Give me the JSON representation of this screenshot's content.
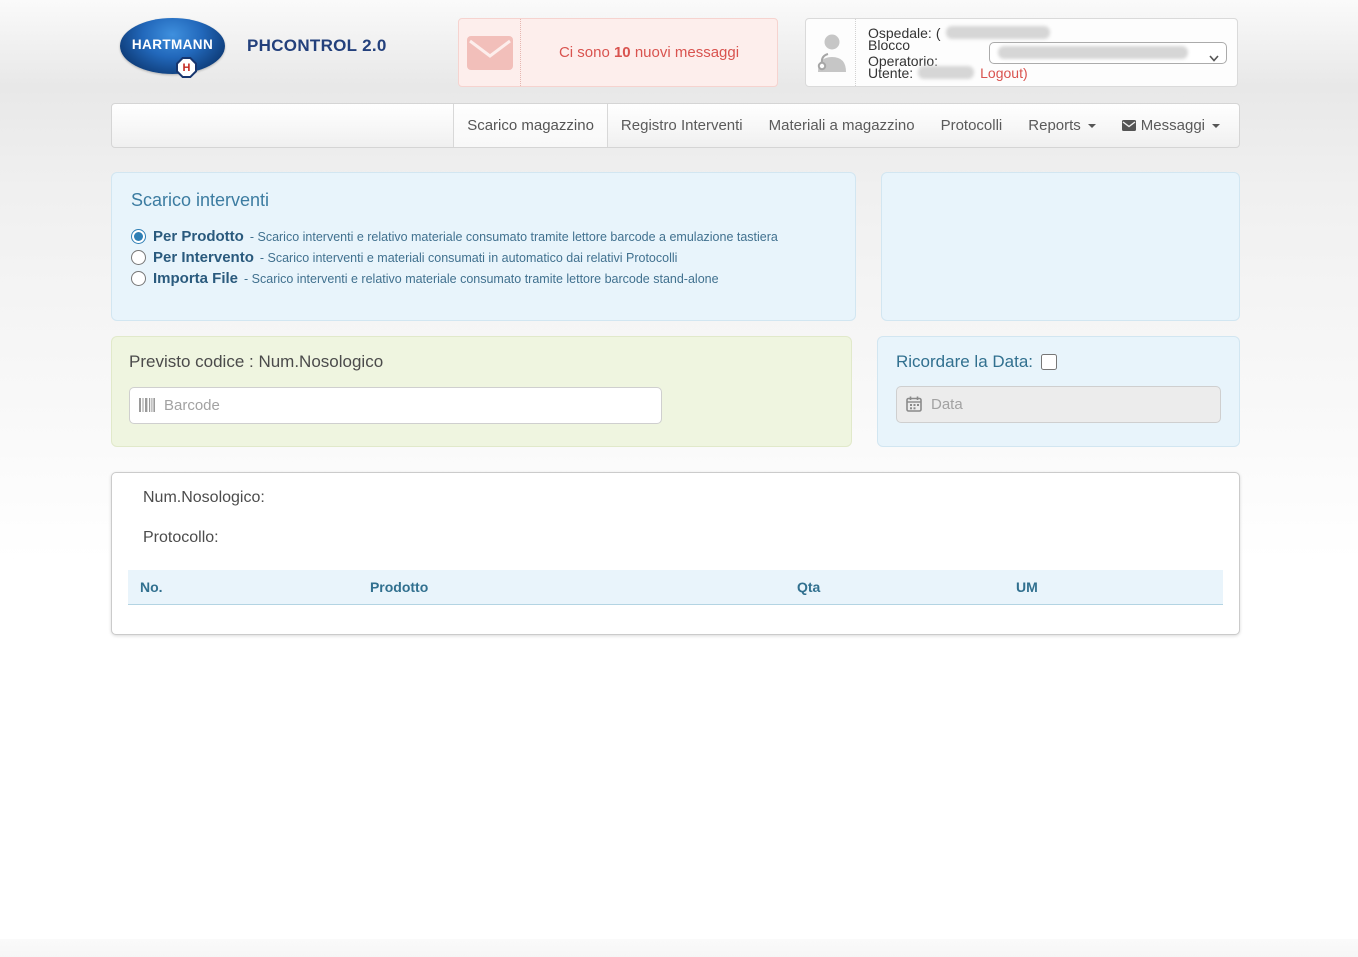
{
  "header": {
    "brand": {
      "logo_text": "HARTMANN",
      "badge_glyph": "H",
      "app_title": "PHCONTROL 2.0"
    },
    "messages": {
      "prefix": "Ci sono ",
      "count": "10",
      "suffix": " nuovi messaggi"
    },
    "user": {
      "ospedale_label": "Ospedale:",
      "ospedale_visible_char": "(",
      "blocco_label": "Blocco Operatorio:",
      "utente_label": "Utente:",
      "logout_label": "Logout)"
    }
  },
  "nav": {
    "tabs": [
      {
        "label": "Scarico magazzino",
        "active": true
      },
      {
        "label": "Registro Interventi",
        "active": false
      },
      {
        "label": "Materiali a magazzino",
        "active": false
      },
      {
        "label": "Protocolli",
        "active": false
      },
      {
        "label": "Reports",
        "active": false,
        "caret": true
      },
      {
        "label": "Messaggi",
        "active": false,
        "caret": true,
        "icon": "envelope-icon"
      }
    ]
  },
  "scarico": {
    "title": "Scarico interventi",
    "options": [
      {
        "label": "Per Prodotto",
        "desc": "- Scarico interventi e relativo materiale consumato tramite lettore barcode a emulazione tastiera",
        "selected": true
      },
      {
        "label": "Per Intervento",
        "desc": "- Scarico interventi e materiali consumati in automatico dai relativi Protocolli",
        "selected": false
      },
      {
        "label": "Importa File",
        "desc": "- Scarico interventi e relativo materiale consumato tramite lettore barcode stand-alone",
        "selected": false
      }
    ]
  },
  "barcode_panel": {
    "title": "Previsto codice : Num.Nosologico",
    "placeholder": "Barcode"
  },
  "date_panel": {
    "title": "Ricordare la Data:",
    "placeholder": "Data",
    "checkbox_checked": false
  },
  "details": {
    "num_nosologico_label": "Num.Nosologico:",
    "protocollo_label": "Protocollo:",
    "table": {
      "columns": [
        "No.",
        "Prodotto",
        "Qta",
        "UM"
      ]
    }
  },
  "colors": {
    "brand_navy": "#23407c",
    "alert_red": "#d9534f",
    "info_blue_bg": "#e8f4fb",
    "info_blue_text": "#31708f",
    "green_bg": "#eff5e0"
  }
}
